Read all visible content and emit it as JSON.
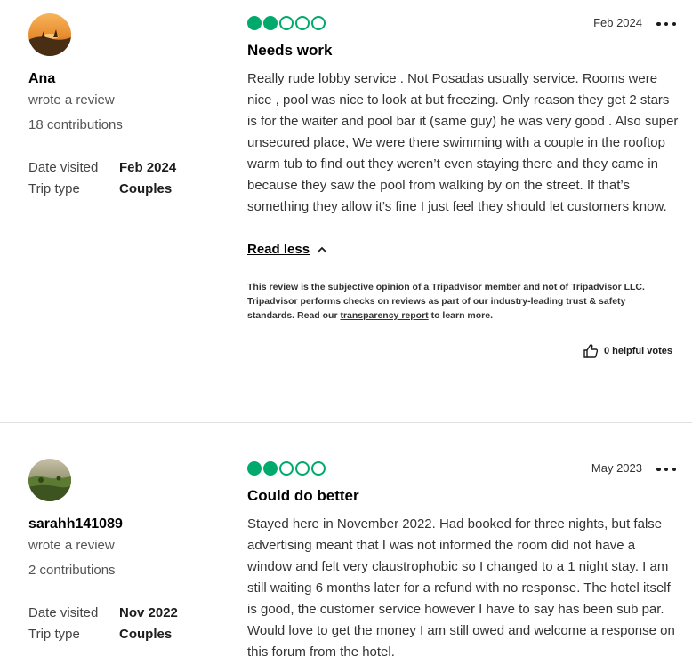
{
  "reviews": [
    {
      "author": "Ana",
      "action": "wrote a review",
      "contributions": "18 contributions",
      "date_visited_label": "Date visited",
      "date_visited": "Feb 2024",
      "trip_type_label": "Trip type",
      "trip_type": "Couples",
      "rating": 2,
      "rating_max": 5,
      "date": "Feb 2024",
      "title": "Needs work",
      "body": "Really rude lobby service . Not Posadas usually service. Rooms were nice , pool was nice to look at but freezing. Only reason they get 2 stars is for the waiter and pool bar it (same guy) he was very good . Also super unsecured place, We were there swimming with a couple in the rooftop warm tub to find out they weren’t even staying there and they came in because they saw the pool from walking by on the street. If that’s something they allow it’s fine I just feel they should let customers know.",
      "read_less": "Read less",
      "disclaimer_before": "This review is the subjective opinion of a Tripadvisor member and not of Tripadvisor LLC. Tripadvisor performs checks on reviews as part of our industry-leading trust & safety standards. Read our ",
      "disclaimer_link": "transparency report",
      "disclaimer_after": " to learn more.",
      "helpful_votes": "0 helpful votes"
    },
    {
      "author": "sarahh141089",
      "action": "wrote a review",
      "contributions": "2 contributions",
      "date_visited_label": "Date visited",
      "date_visited": "Nov 2022",
      "trip_type_label": "Trip type",
      "trip_type": "Couples",
      "rating": 2,
      "rating_max": 5,
      "date": "May 2023",
      "title": "Could do better",
      "body": "Stayed here in November 2022. Had booked for three nights, but false advertising meant that I was not informed the room did not have a window and felt very claustrophobic so I changed to a 1 night stay. I am still waiting 6 months later for a refund with no response. The hotel itself is good, the customer service however I have to say has been sub par. Would love to get the money I am still owed and welcome a response on this forum from the hotel."
    }
  ],
  "colors": {
    "rating_green": "#00aa6c",
    "divider": "#e0e0e0"
  }
}
